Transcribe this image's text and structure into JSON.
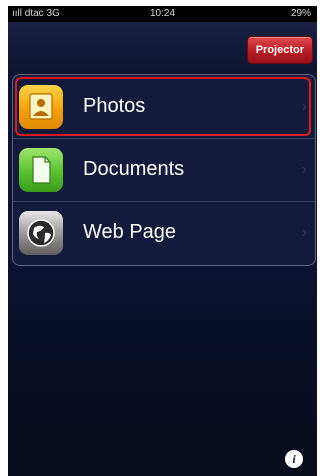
{
  "status_bar": {
    "carrier": "ııll dtac 3G",
    "time": "10:24",
    "battery": "29%"
  },
  "navbar": {
    "projector_button": "Projector"
  },
  "menu": {
    "items": [
      {
        "label": "Photos",
        "icon": "photo-frame-icon"
      },
      {
        "label": "Documents",
        "icon": "document-icon"
      },
      {
        "label": "Web Page",
        "icon": "globe-icon"
      }
    ]
  },
  "footer": {
    "info_icon": "i"
  },
  "colors": {
    "background": "#0c1230",
    "projector_button": "#c42830",
    "selection_border": "#d91b22"
  }
}
